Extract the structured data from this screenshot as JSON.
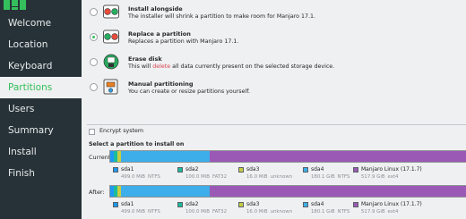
{
  "sidebar": {
    "items": [
      {
        "label": "Welcome",
        "active": false
      },
      {
        "label": "Location",
        "active": false
      },
      {
        "label": "Keyboard",
        "active": false
      },
      {
        "label": "Partitions",
        "active": true
      },
      {
        "label": "Users",
        "active": false
      },
      {
        "label": "Summary",
        "active": false
      },
      {
        "label": "Install",
        "active": false
      },
      {
        "label": "Finish",
        "active": false
      }
    ],
    "accent": "#35bf5c",
    "bg": "#263238"
  },
  "options": [
    {
      "title": "Install alongside",
      "desc": "The installer will shrink a partition to make room for Manjaro 17.1.",
      "selected": false,
      "icon": "install-alongside-icon"
    },
    {
      "title": "Replace a partition",
      "desc": "Replaces a partition with Manjaro 17.1.",
      "selected": true,
      "icon": "replace-partition-icon"
    },
    {
      "title": "Erase disk",
      "desc_pre": "This will ",
      "desc_danger": "delete",
      "desc_post": " all data currently present on the selected storage device.",
      "selected": false,
      "icon": "erase-disk-icon"
    },
    {
      "title": "Manual partitioning",
      "desc": "You can create or resize partitions yourself.",
      "selected": false,
      "icon": "manual-partitioning-icon"
    }
  ],
  "encrypt_label": "Encrypt system",
  "select_label": "Select a partition to install on",
  "current_label": "Current:",
  "after_label": "After:",
  "partitions": [
    {
      "name": "sda1",
      "size": "499.0 MiB",
      "fs": "NTFS",
      "color": "#1d99f3",
      "fraction": 0.0005
    },
    {
      "name": "sda2",
      "size": "100.0 MiB",
      "fs": "FAT32",
      "color": "#1abc9c",
      "fraction": 0.0001
    },
    {
      "name": "sda3",
      "size": "16.0 MiB",
      "fs": "unknown",
      "color": "#c8cc44",
      "fraction": 0.0001
    },
    {
      "name": "sda4",
      "size": "180.1 GiB",
      "fs": "NTFS",
      "color": "#3daee9",
      "fraction": 0.258
    },
    {
      "name": "Manjaro Linux (17.1.7)",
      "size": "517.9 GiB",
      "fs": "ext4",
      "color": "#9b59b6",
      "fraction": 0.742
    }
  ]
}
